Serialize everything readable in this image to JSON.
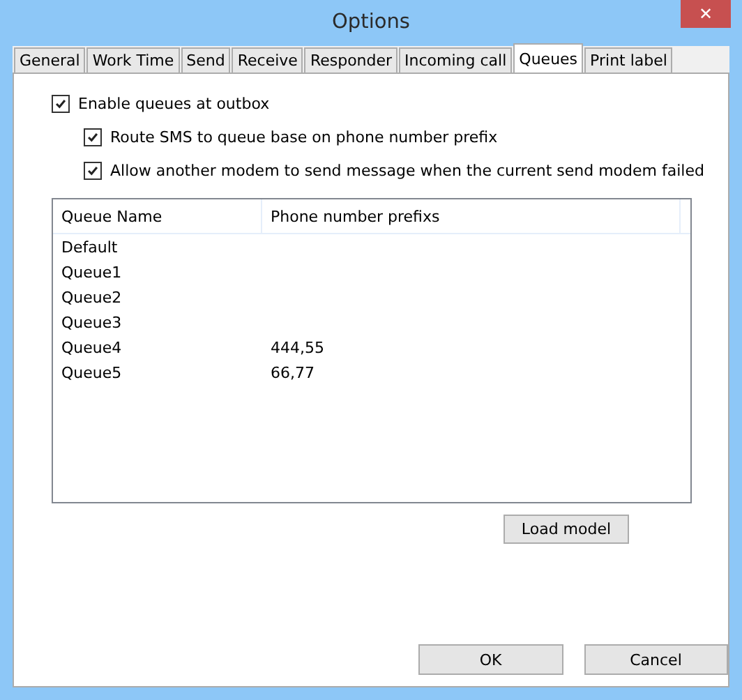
{
  "window": {
    "title": "Options",
    "close": "✕"
  },
  "tabs": [
    {
      "label": "General",
      "selected": false
    },
    {
      "label": "Work Time",
      "selected": false
    },
    {
      "label": "Send",
      "selected": false
    },
    {
      "label": "Receive",
      "selected": false
    },
    {
      "label": "Responder",
      "selected": false
    },
    {
      "label": "Incoming call",
      "selected": false
    },
    {
      "label": "Queues",
      "selected": true
    },
    {
      "label": "Print label",
      "selected": false
    }
  ],
  "options": [
    {
      "label": "Enable queues at outbox",
      "checked": true,
      "indented": false
    },
    {
      "label": "Route SMS to queue base on phone number prefix",
      "checked": true,
      "indented": true
    },
    {
      "label": "Allow another modem to send message when the current send modem failed",
      "checked": true,
      "indented": true
    }
  ],
  "table": {
    "columns": [
      "Queue Name",
      "Phone number prefixs"
    ],
    "rows": [
      [
        "Default",
        ""
      ],
      [
        "Queue1",
        ""
      ],
      [
        "Queue2",
        ""
      ],
      [
        "Queue3",
        ""
      ],
      [
        "Queue4",
        "444,55"
      ],
      [
        "Queue5",
        "66,77"
      ]
    ]
  },
  "load_button": "Load model",
  "buttons": [
    "OK",
    "Cancel"
  ]
}
